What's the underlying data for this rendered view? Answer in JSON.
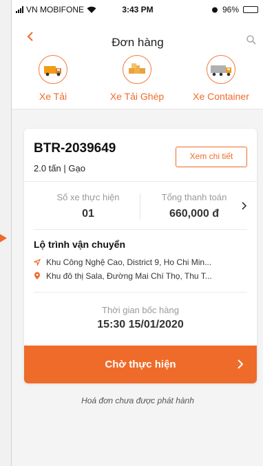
{
  "status_bar": {
    "carrier": "VN MOBIFONE",
    "time": "3:43 PM",
    "battery": "96%",
    "battery_level": 0.96
  },
  "header": {
    "title": "Đơn hàng"
  },
  "vehicle_types": [
    {
      "label": "Xe Tải",
      "icon": "truck-icon"
    },
    {
      "label": "Xe Tải Ghép",
      "icon": "boxes-icon"
    },
    {
      "label": "Xe Container",
      "icon": "container-truck-icon"
    }
  ],
  "order": {
    "code": "BTR-2039649",
    "sub": "2.0 tấn | Gạo",
    "detail_button": "Xem chi tiết",
    "trucks_label": "Số xe thực hiện",
    "trucks_value": "01",
    "total_label": "Tổng thanh toán",
    "total_value": "660,000 đ",
    "route_title": "Lộ trình vận chuyển",
    "route_from": "Khu Công Nghệ Cao, District 9, Ho Chi Min...",
    "route_to": "Khu đô thị Sala, Đường Mai Chí Thọ, Thu T...",
    "pickup_label": "Thời gian bốc hàng",
    "pickup_time": "15:30 15/01/2020",
    "status_button": "Chờ thực hiện"
  },
  "footer_note": "Hoá đơn chưa được phát hành",
  "colors": {
    "accent": "#ef6a2a"
  }
}
